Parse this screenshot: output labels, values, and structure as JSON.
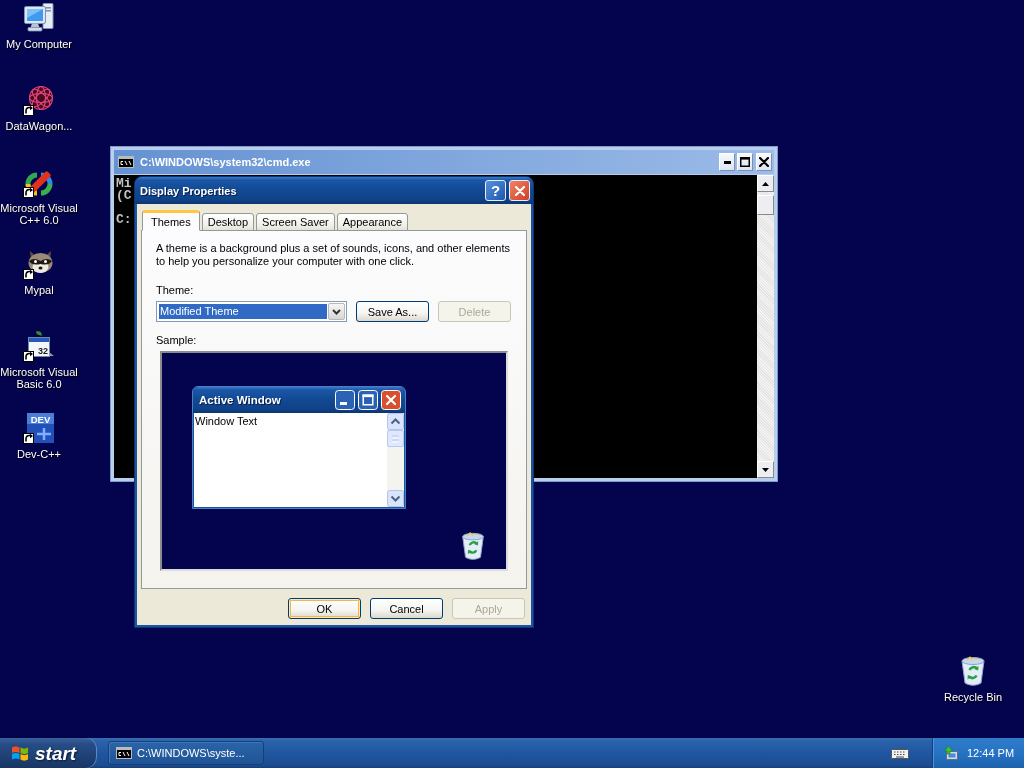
{
  "desktop": {
    "icons": [
      {
        "label": "My Computer",
        "shortcut": false
      },
      {
        "label": "DataWagon...",
        "shortcut": true
      },
      {
        "label": "Microsoft Visual C++ 6.0",
        "shortcut": true
      },
      {
        "label": "Mypal",
        "shortcut": true
      },
      {
        "label": "Microsoft Visual Basic 6.0",
        "shortcut": true,
        "icon_text": "32"
      },
      {
        "label": "Dev-C++",
        "shortcut": true,
        "icon_text": "DEV"
      }
    ],
    "recycle_bin": {
      "label": "Recycle Bin"
    }
  },
  "console_window": {
    "title": "C:\\WINDOWS\\system32\\cmd.exe",
    "active": false,
    "lines": [
      "Mi",
      "(C"
    ],
    "prompt": "C:"
  },
  "dialog": {
    "title": "Display Properties",
    "active": true,
    "help_label": "?",
    "tabs": [
      {
        "label": "Themes",
        "selected": true
      },
      {
        "label": "Desktop",
        "selected": false
      },
      {
        "label": "Screen Saver",
        "selected": false
      },
      {
        "label": "Appearance",
        "selected": false
      }
    ],
    "description": "A theme is a background plus a set of sounds, icons, and other elements to help you personalize your computer with one click.",
    "theme_label": "Theme:",
    "theme_select": {
      "value": "Modified Theme",
      "focused": true
    },
    "theme_buttons": [
      {
        "label": "Save As...",
        "disabled": false
      },
      {
        "label": "Delete",
        "disabled": true
      }
    ],
    "sample_label": "Sample:",
    "sample": {
      "window_title": "Active Window",
      "window_text": "Window Text"
    },
    "buttons": [
      {
        "label": "OK",
        "default": true,
        "disabled": false
      },
      {
        "label": "Cancel",
        "default": false,
        "disabled": false
      },
      {
        "label": "Apply",
        "default": false,
        "disabled": true
      }
    ]
  },
  "taskbar": {
    "start_label": "start",
    "tasks": [
      {
        "label": "C:\\WINDOWS\\syste..."
      }
    ],
    "clock": "12:44 PM"
  }
}
